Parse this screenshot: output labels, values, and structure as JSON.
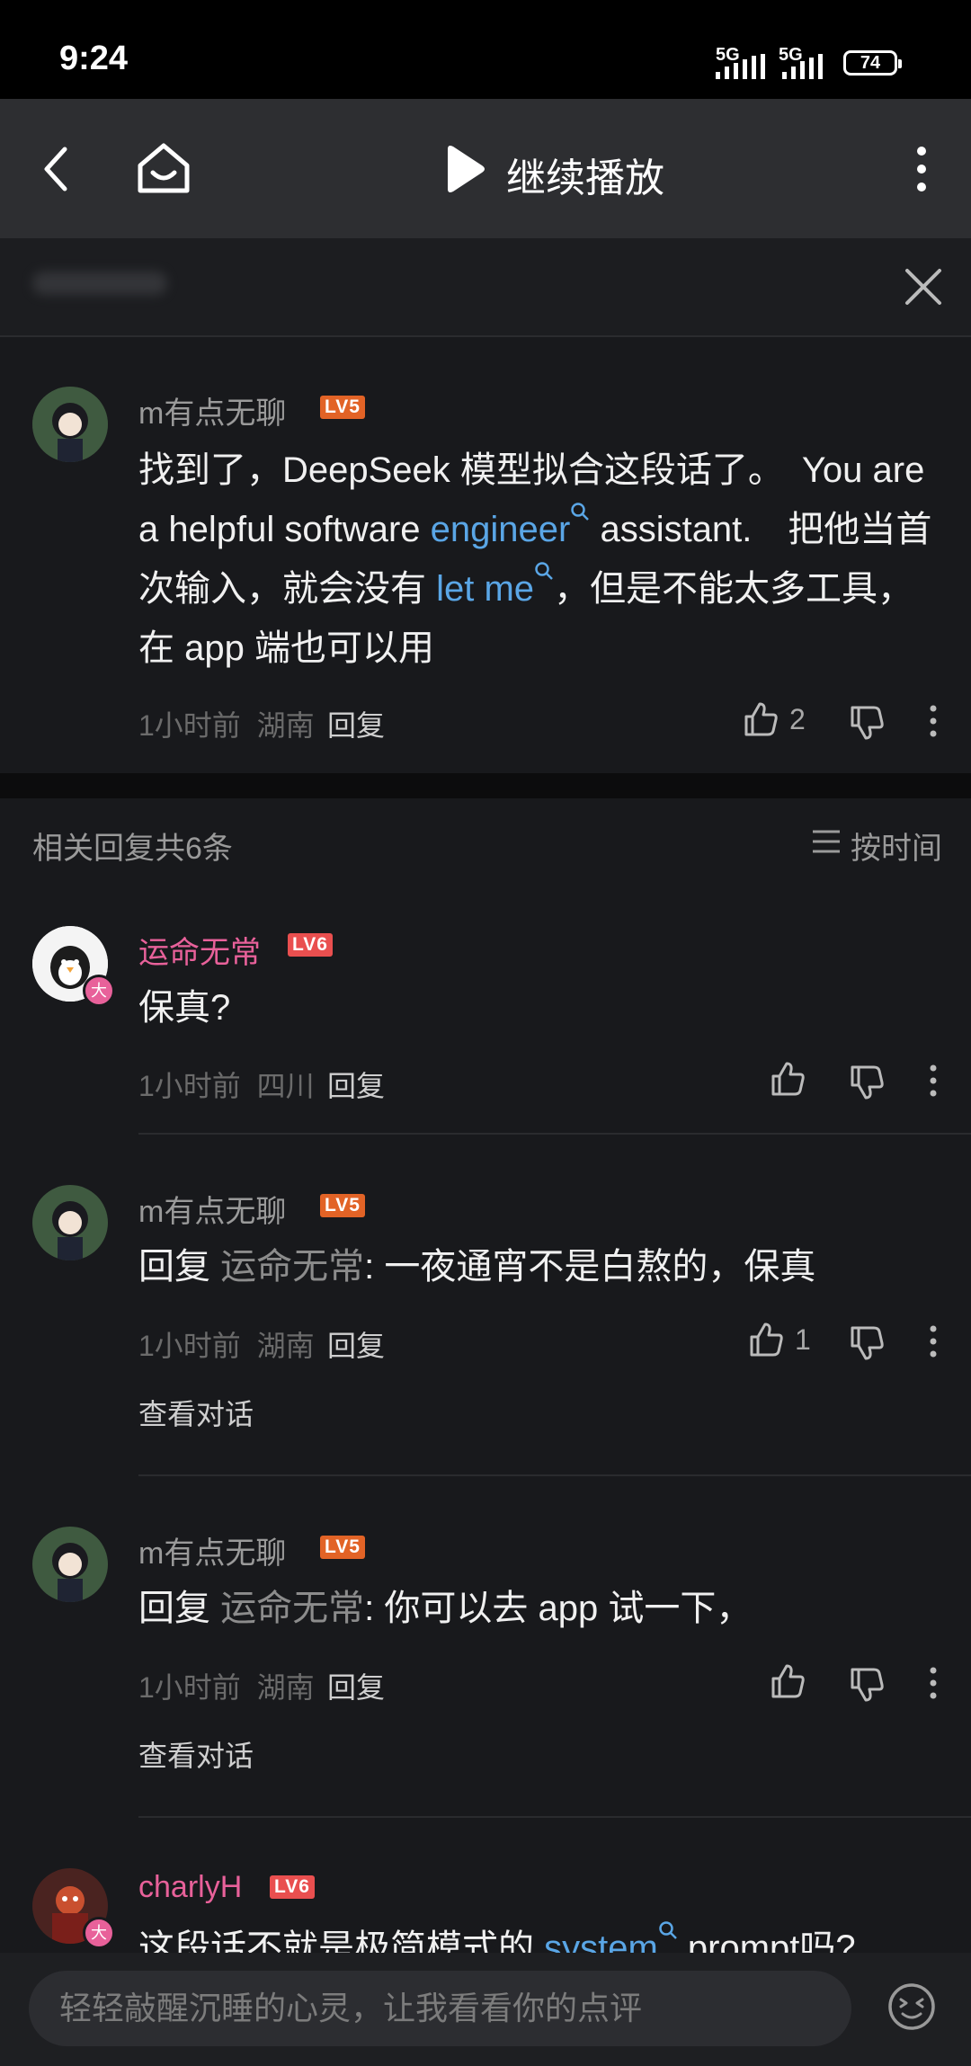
{
  "status_bar": {
    "time": "9:24",
    "network_1": "5G",
    "network_2": "5G",
    "battery": "74"
  },
  "top_bar": {
    "play_label": "继续播放"
  },
  "main_comment": {
    "username": "m有点无聊",
    "level": "LV5",
    "text_before_link1": "找到了，DeepSeek 模型拟合这段话了。　You are a helpful software ",
    "link1": "engineer",
    "text_between": " assistant.　把他当首次输入，就会没有 ",
    "link2": "let me",
    "text_after": "，但是不能太多工具，在 app 端也可以用",
    "time": "1小时前",
    "location": "湖南",
    "reply_label": "回复",
    "like_count": "2"
  },
  "replies_header": {
    "title": "相关回复共6条",
    "sort_label": "按时间"
  },
  "replies": [
    {
      "username": "运命无常",
      "level": "LV6",
      "badge": "大",
      "text": "保真?",
      "time": "1小时前",
      "location": "四川",
      "reply_label": "回复"
    },
    {
      "username": "m有点无聊",
      "level": "LV5",
      "reply_prefix": "回复",
      "quote_user": "运命无常",
      "text": ": 一夜通宵不是白熬的，保真",
      "time": "1小时前",
      "location": "湖南",
      "reply_label": "回复",
      "like_count": "1",
      "view_conversation": "查看对话"
    },
    {
      "username": "m有点无聊",
      "level": "LV5",
      "reply_prefix": "回复",
      "quote_user": "运命无常",
      "text": ": 你可以去 app 试一下，",
      "time": "1小时前",
      "location": "湖南",
      "reply_label": "回复",
      "view_conversation": "查看对话"
    },
    {
      "username": "charlyH",
      "level": "LV6",
      "badge": "大",
      "text_before_link": "这段话不就是极简模式的 ",
      "link": "system",
      "text_after": " prompt吗?"
    }
  ],
  "input": {
    "placeholder": "轻轻敲醒沉睡的心灵，让我看看你的点评"
  },
  "colors": {
    "background": "#18191c",
    "link": "#5aa6e6",
    "pink_name": "#e8619a",
    "level_badge": "#e26326"
  }
}
